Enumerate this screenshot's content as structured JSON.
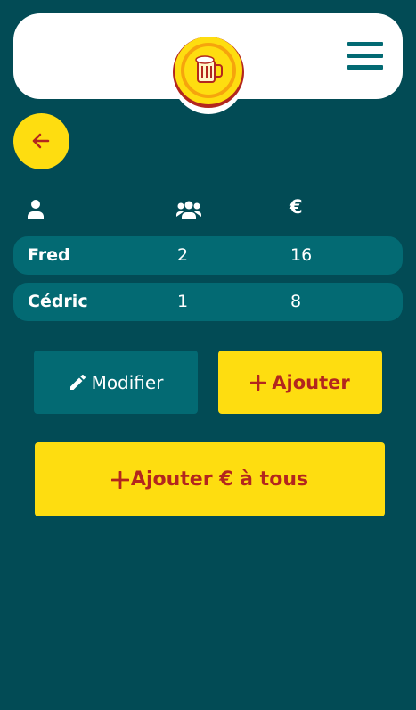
{
  "header": {
    "logo": "beer-mug-logo",
    "menu_icon": "hamburger-menu-icon"
  },
  "navigation": {
    "back_icon": "arrow-left-icon"
  },
  "table": {
    "columns": [
      {
        "icon": "person-icon"
      },
      {
        "icon": "group-icon"
      },
      {
        "label": "€"
      }
    ],
    "rows": [
      {
        "name": "Fred",
        "count": "2",
        "amount": "16"
      },
      {
        "name": "Cédric",
        "count": "1",
        "amount": "8"
      }
    ]
  },
  "actions": {
    "edit_label": "Modifier",
    "edit_icon": "pencil-icon",
    "add_label": "Ajouter",
    "add_icon": "plus-icon",
    "add_all_label": "Ajouter € à tous",
    "add_all_icon": "plus-icon"
  },
  "colors": {
    "background": "#024b55",
    "row_background": "#036a73",
    "accent_yellow": "#fedd10",
    "accent_red": "#b3261e",
    "white": "#ffffff"
  }
}
